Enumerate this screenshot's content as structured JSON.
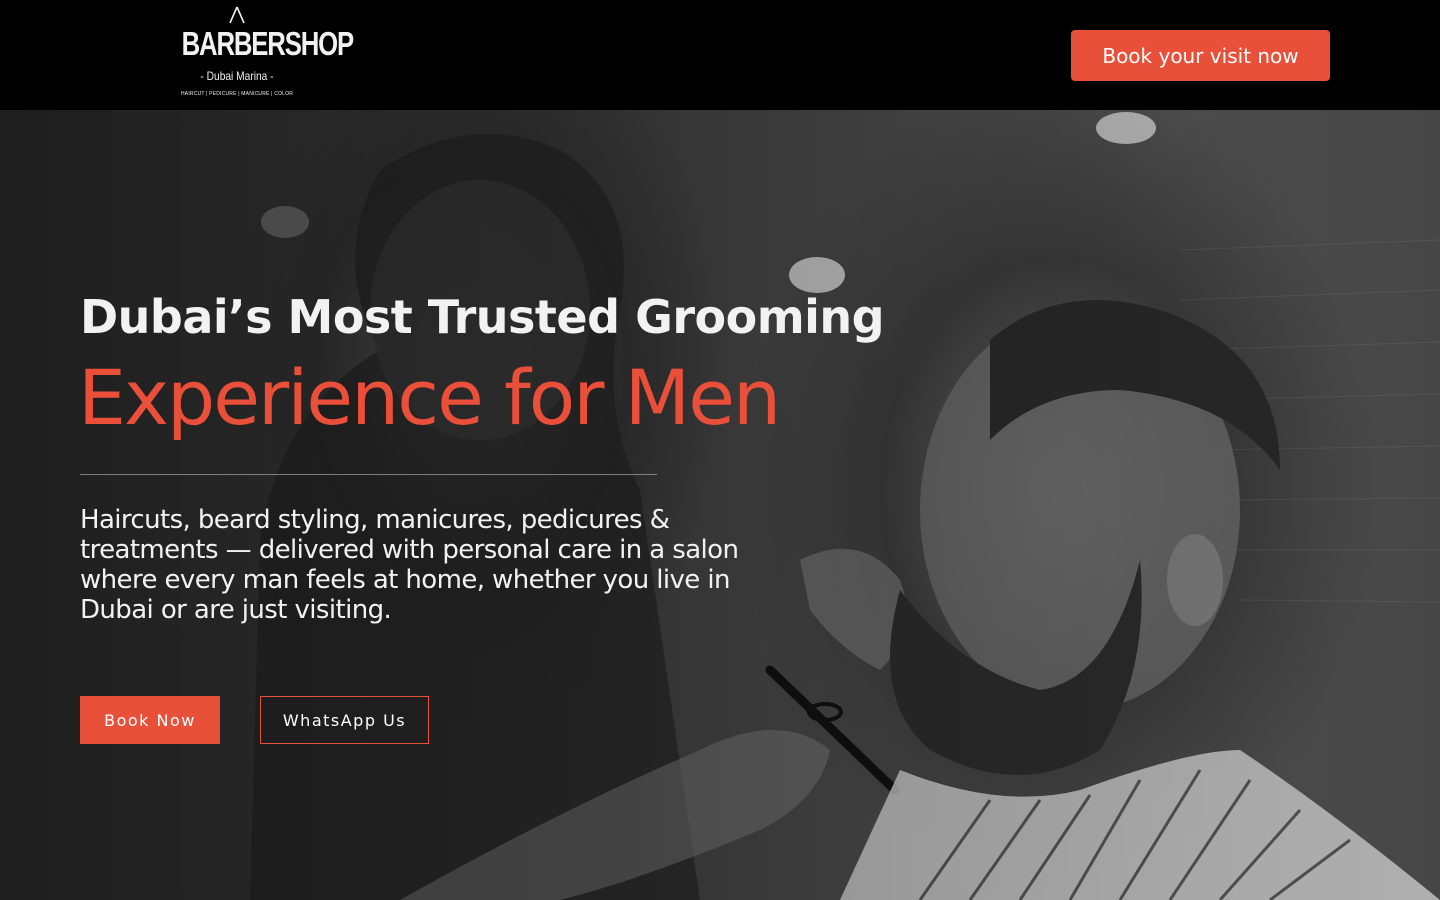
{
  "header": {
    "logo": {
      "wordmark": "BARBERSHOP",
      "location": "- Dubai Marina -",
      "services": "HAIRCUT | PEDICURE | MANICURE | COLOR"
    },
    "cta_label": "Book your visit now"
  },
  "hero": {
    "headline_line1": "Dubai’s Most Trusted Grooming",
    "headline_line2": "Experience for Men",
    "description": "Haircuts, beard styling, manicures, pedicures & treatments — delivered with personal care in a salon where every man feels at home, whether you live in Dubai or are just visiting.",
    "primary_button": "Book Now",
    "secondary_button": "WhatsApp Us",
    "background_image": "barber-trimming-beard-photo"
  },
  "colors": {
    "accent": "#e8503a",
    "header_bg": "#000000",
    "text_light": "#f2f2f2"
  }
}
